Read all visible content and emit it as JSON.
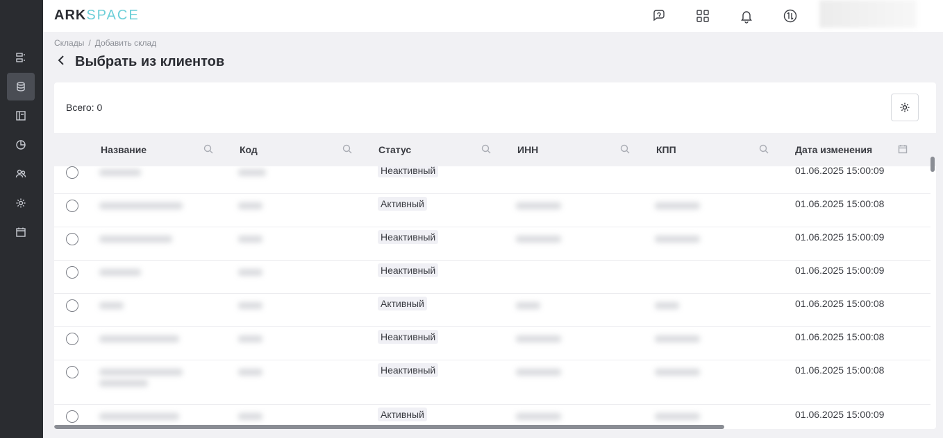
{
  "header": {
    "logo": {
      "ark": "ARK",
      "space": "SPACE"
    },
    "icons": [
      "support-chat-icon",
      "apps-grid-icon",
      "bell-icon",
      "sync-icon"
    ]
  },
  "sidebar": {
    "items": [
      "list-icon",
      "database-icon",
      "layout-icon",
      "chart-pie-icon",
      "users-icon",
      "gear-icon",
      "calendar-icon"
    ],
    "active_index": 1
  },
  "breadcrumb": {
    "items": [
      "Склады",
      "Добавить склад"
    ],
    "separator": "/"
  },
  "page": {
    "title": "Выбрать из клиентов"
  },
  "table": {
    "total_label": "Всего: 0",
    "columns": [
      "Название",
      "Код",
      "Статус",
      "ИНН",
      "КПП",
      "Дата изменения"
    ],
    "rows": [
      {
        "status": "Неактивный",
        "date": "01.06.2025 15:00:09"
      },
      {
        "status": "Активный",
        "date": "01.06.2025 15:00:08"
      },
      {
        "status": "Неактивный",
        "date": "01.06.2025 15:00:09"
      },
      {
        "status": "Неактивный",
        "date": "01.06.2025 15:00:09"
      },
      {
        "status": "Активный",
        "date": "01.06.2025 15:00:08"
      },
      {
        "status": "Неактивный",
        "date": "01.06.2025 15:00:08"
      },
      {
        "status": "Неактивный",
        "date": "01.06.2025 15:00:08"
      },
      {
        "status": "Активный",
        "date": "01.06.2025 15:00:09"
      }
    ]
  }
}
